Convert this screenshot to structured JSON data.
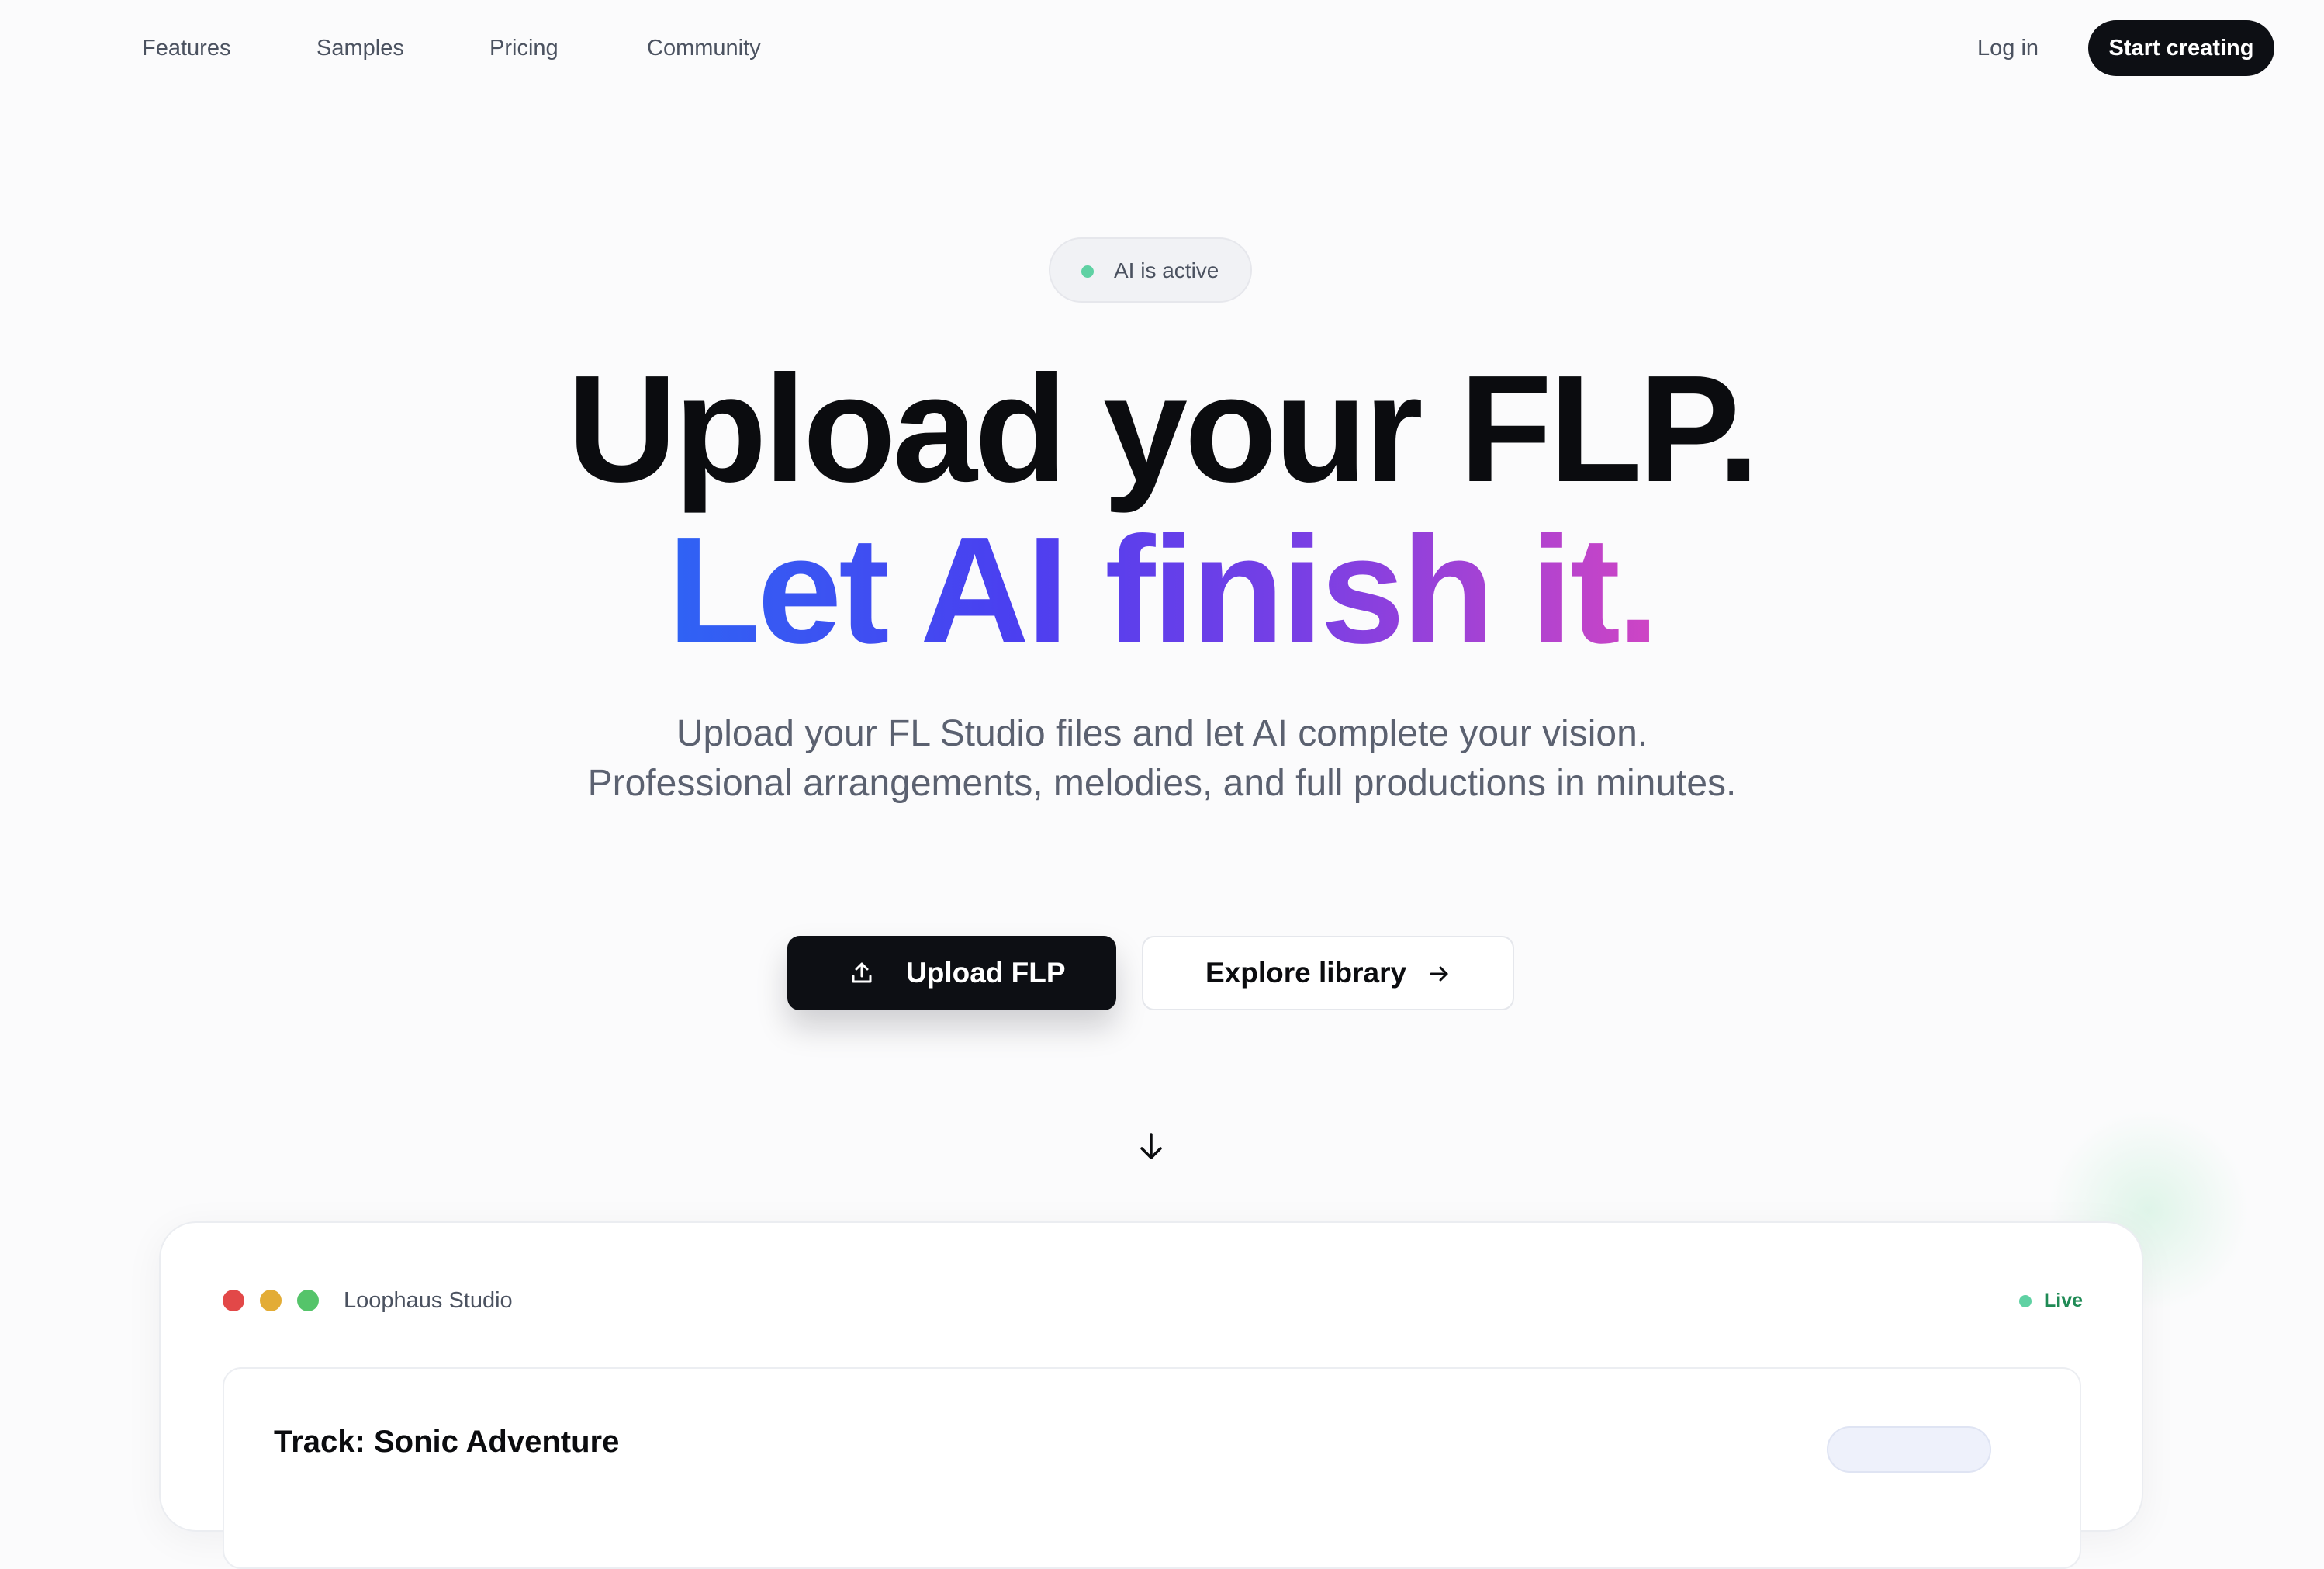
{
  "nav": {
    "links": [
      "Features",
      "Samples",
      "Pricing",
      "Community"
    ],
    "login_label": "Log in",
    "cta_label": "Start creating"
  },
  "status": {
    "label": "AI is active",
    "dot_color": "#5fd1a3"
  },
  "hero": {
    "line1": "Upload your FLP.",
    "line2": "Let AI finish it.",
    "gradient_colors": [
      "#2f63f4",
      "#4b3ff0",
      "#7a3fe4",
      "#cf45c4"
    ],
    "subtitle": "Upload your FL Studio files and let AI complete your vision. Professional arrangements, melodies, and full productions in minutes."
  },
  "actions": {
    "upload_label": "Upload FLP",
    "upload_icon": "upload-icon",
    "explore_label": "Explore library",
    "explore_icon": "arrow-right-icon",
    "scroll_icon": "arrow-down-icon"
  },
  "studio": {
    "name": "Loophaus Studio",
    "window_dots": [
      "#e24848",
      "#e3ac35",
      "#55c46a"
    ],
    "live_label": "Live",
    "live_color": "#1f8a55",
    "track_title": "Track: Sonic Adventure"
  },
  "colors": {
    "primary_dark": "#0d0f14",
    "text_muted": "#5b6170",
    "background": "#fbfbfc"
  }
}
